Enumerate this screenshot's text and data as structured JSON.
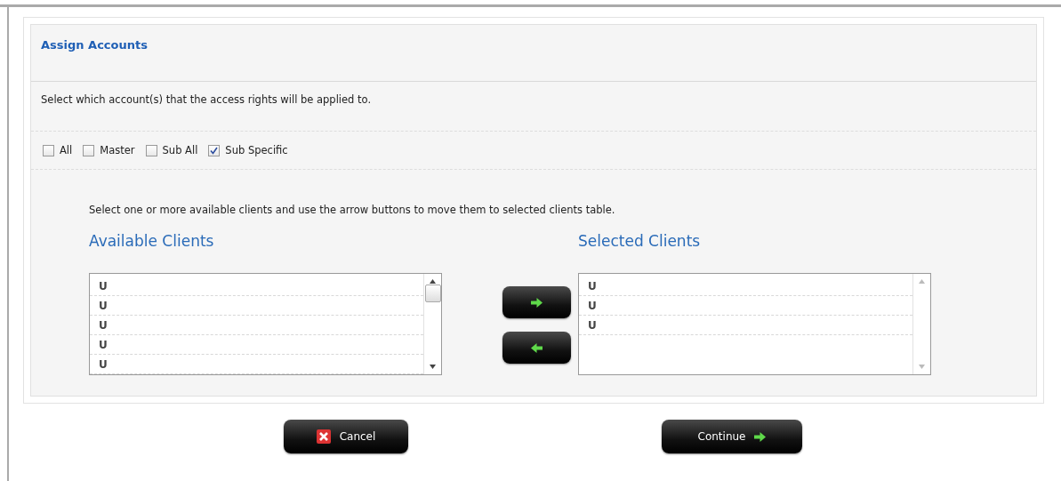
{
  "panel": {
    "title": "Assign Accounts",
    "description": "Select which account(s) that the access rights will be applied to.",
    "account_options": [
      {
        "label": "All",
        "checked": false
      },
      {
        "label": "Master",
        "checked": false
      },
      {
        "label": "Sub All",
        "checked": false
      },
      {
        "label": "Sub Specific",
        "checked": true
      }
    ],
    "instruction": "Select one or more available clients and use the arrow buttons to move them to selected clients table.",
    "available_clients": {
      "heading": "Available Clients",
      "scrollable": true,
      "items": [
        {
          "text": "U"
        },
        {
          "text": "U"
        },
        {
          "text": "U"
        },
        {
          "text": "U"
        },
        {
          "text": "U"
        }
      ]
    },
    "move_buttons": [
      {
        "kind": "add"
      },
      {
        "kind": "remove"
      }
    ],
    "selected_clients": {
      "heading": "Selected Clients",
      "scrollable": false,
      "items": [
        {
          "text": "U"
        },
        {
          "text": "U"
        },
        {
          "text": "U"
        }
      ]
    }
  },
  "buttons": [
    {
      "kind": "cancel",
      "label": "Cancel"
    },
    {
      "kind": "continue",
      "label": "Continue"
    }
  ]
}
